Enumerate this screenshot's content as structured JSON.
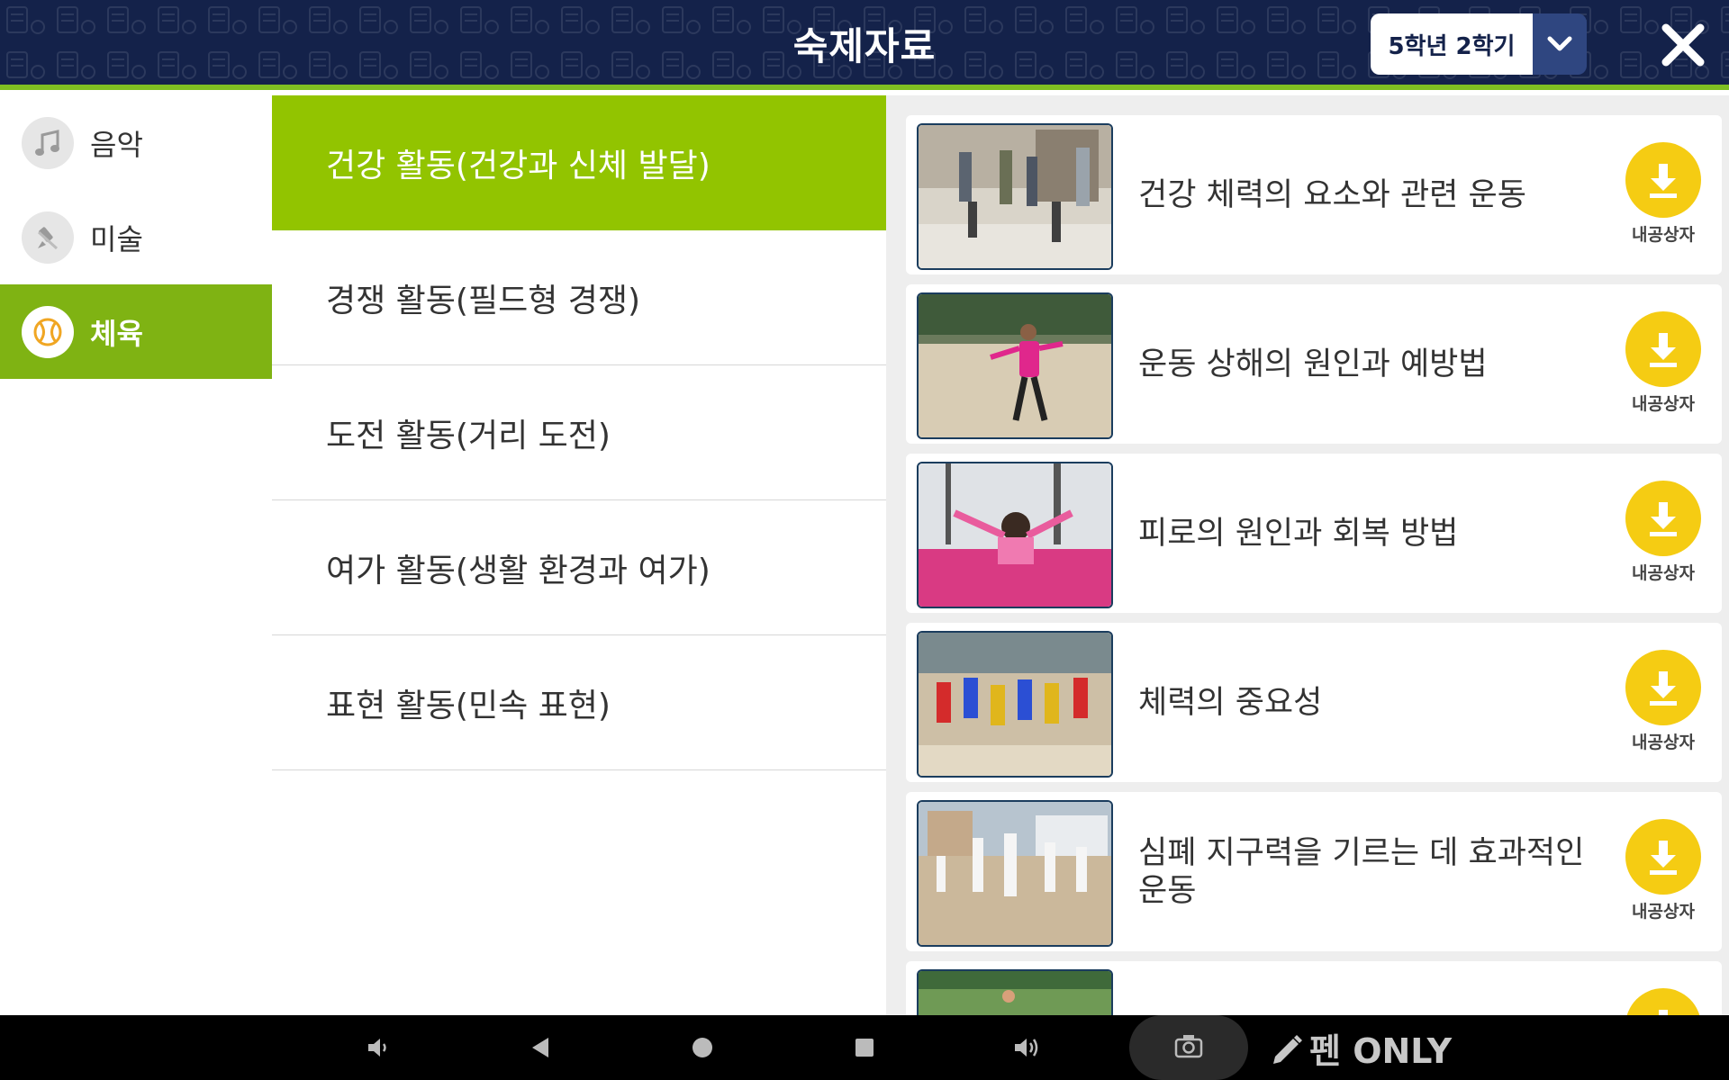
{
  "header": {
    "title": "숙제자료",
    "semester_selected": "5학년 2학기"
  },
  "subjects": [
    {
      "label": "음악",
      "icon": "music-note-icon",
      "active": false
    },
    {
      "label": "미술",
      "icon": "paintbrush-icon",
      "active": false
    },
    {
      "label": "체육",
      "icon": "ball-icon",
      "active": true
    }
  ],
  "units": [
    {
      "label": "건강 활동(건강과 신체 발달)",
      "active": true
    },
    {
      "label": "경쟁 활동(필드형 경쟁)",
      "active": false
    },
    {
      "label": "도전 활동(거리 도전)",
      "active": false
    },
    {
      "label": "여가 활동(생활 환경과 여가)",
      "active": false
    },
    {
      "label": "표현 활동(민속 표현)",
      "active": false
    }
  ],
  "materials": [
    {
      "title": "건강 체력의 요소와 관련 운동",
      "download_label": "내공상자"
    },
    {
      "title": "운동 상해의 원인과 예방법",
      "download_label": "내공상자"
    },
    {
      "title": "피로의 원인과 회복 방법",
      "download_label": "내공상자"
    },
    {
      "title": "체력의 중요성",
      "download_label": "내공상자"
    },
    {
      "title": "심폐 지구력을 기르는 데 효과적인 운동",
      "download_label": "내공상자"
    },
    {
      "title": "",
      "download_label": ""
    }
  ],
  "navbar": {
    "pen_label": "펜 ONLY"
  },
  "colors": {
    "header_bg": "#14224a",
    "accent_green": "#92c400",
    "subject_active": "#7fb313",
    "download_yellow": "#f5cc13"
  }
}
